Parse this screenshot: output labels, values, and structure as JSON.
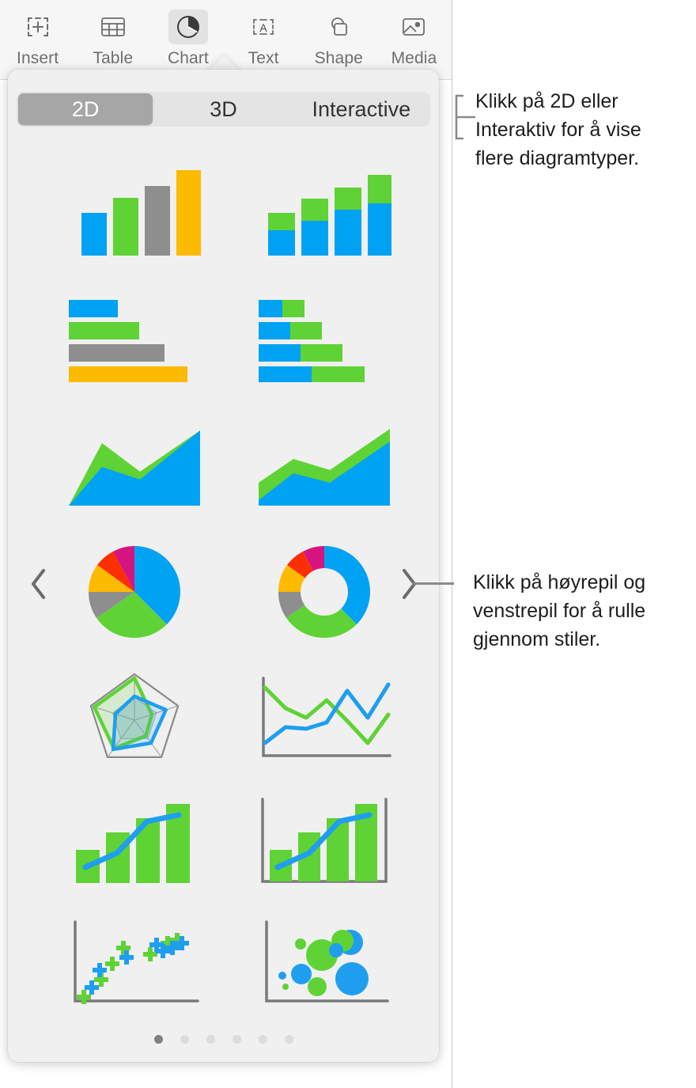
{
  "window": {
    "title": "Keynote chart picker"
  },
  "toolbar": {
    "items": [
      {
        "label": "Insert",
        "icon": "insert-icon",
        "active": false
      },
      {
        "label": "Table",
        "icon": "table-icon",
        "active": false
      },
      {
        "label": "Chart",
        "icon": "chart-icon",
        "active": true
      },
      {
        "label": "Text",
        "icon": "text-icon",
        "active": false
      },
      {
        "label": "Shape",
        "icon": "shape-icon",
        "active": false
      },
      {
        "label": "Media",
        "icon": "media-icon",
        "active": false
      }
    ]
  },
  "popover": {
    "segmented": {
      "options": [
        "2D",
        "3D",
        "Interactive"
      ],
      "selected": "2D"
    },
    "charts": [
      {
        "name": "column-chart",
        "type": "column",
        "colors": [
          "#00a2f3",
          "#5fd335",
          "#8e8e8e",
          "#fcba00"
        ],
        "values": [
          45,
          62,
          80,
          100
        ]
      },
      {
        "name": "stacked-column-chart",
        "type": "stacked-column",
        "colors": [
          "#00a2f3",
          "#5fd335"
        ],
        "series": [
          {
            "name": "blue",
            "values": [
              22,
              42,
              58,
              70
            ]
          },
          {
            "name": "green",
            "values": [
              28,
              30,
              35,
              40
            ]
          }
        ]
      },
      {
        "name": "bar-chart",
        "type": "bar",
        "colors": [
          "#00a2f3",
          "#5fd335",
          "#8e8e8e",
          "#fcba00"
        ],
        "values": [
          38,
          50,
          63,
          83
        ]
      },
      {
        "name": "stacked-bar-chart",
        "type": "stacked-bar",
        "colors": [
          "#00a2f3",
          "#5fd335"
        ],
        "series": [
          {
            "name": "blue",
            "values": [
              30,
              38,
              47,
              56
            ]
          },
          {
            "name": "green",
            "values": [
              20,
              28,
              36,
              44
            ]
          }
        ]
      },
      {
        "name": "area-chart",
        "type": "area",
        "colors": [
          "#5fd335",
          "#00a2f3"
        ],
        "series": [
          {
            "name": "green",
            "values": [
              0,
              72,
              40,
              44,
              96
            ]
          },
          {
            "name": "blue",
            "values": [
              0,
              46,
              32,
              60,
              100
            ]
          }
        ]
      },
      {
        "name": "stacked-area-chart",
        "type": "stacked-area",
        "colors": [
          "#5fd335",
          "#00a2f3"
        ],
        "series": [
          {
            "name": "green",
            "values": [
              22,
              62,
              44,
              62,
              100
            ]
          },
          {
            "name": "blue",
            "values": [
              8,
              36,
              30,
              50,
              88
            ]
          }
        ]
      },
      {
        "name": "pie-chart",
        "type": "pie",
        "colors": [
          "#00a2f3",
          "#5fd335",
          "#8e8e8e",
          "#fcba00",
          "#fc2f00",
          "#d6147f"
        ],
        "values": [
          33,
          28,
          10,
          11,
          10,
          8
        ]
      },
      {
        "name": "donut-chart",
        "type": "donut",
        "colors": [
          "#00a2f3",
          "#5fd335",
          "#8e8e8e",
          "#fcba00",
          "#fc2f00",
          "#d6147f"
        ],
        "values": [
          33,
          28,
          10,
          11,
          10,
          8
        ]
      },
      {
        "name": "radar-chart",
        "type": "radar",
        "colors": [
          "#5fd335",
          "#1f9ef0"
        ],
        "series": [
          {
            "name": "green",
            "values": [
              92,
              40,
              55,
              78,
              35
            ]
          },
          {
            "name": "blue",
            "values": [
              52,
              72,
              85,
              38,
              42
            ]
          }
        ]
      },
      {
        "name": "line-chart",
        "type": "line",
        "colors": [
          "#5fd335",
          "#1f9ef0"
        ],
        "series": [
          {
            "name": "green",
            "values": [
              88,
              58,
              62,
              36,
              84,
              28,
              60
            ]
          },
          {
            "name": "blue",
            "values": [
              18,
              44,
              40,
              76,
              92,
              50,
              92
            ]
          }
        ]
      },
      {
        "name": "combo-chart",
        "type": "combo",
        "colors": [
          "#5fd335",
          "#1f9ef0"
        ],
        "bars": [
          32,
          58,
          78,
          96
        ],
        "line": [
          10,
          30,
          72,
          80
        ]
      },
      {
        "name": "two-axis-chart",
        "type": "two-axis",
        "colors": [
          "#5fd335",
          "#1f9ef0"
        ],
        "bars": [
          32,
          58,
          78,
          96
        ],
        "line": [
          10,
          30,
          72,
          80
        ]
      },
      {
        "name": "scatter-chart",
        "type": "scatter",
        "colors": [
          "#5fd335",
          "#1f9ef0"
        ],
        "series": [
          {
            "name": "green",
            "points": [
              [
                4,
                4
              ],
              [
                13,
                22
              ],
              [
                27,
                42
              ],
              [
                38,
                56
              ],
              [
                62,
                50
              ],
              [
                72,
                58
              ],
              [
                80,
                62
              ]
            ]
          },
          {
            "name": "blue",
            "points": [
              [
                8,
                6
              ],
              [
                18,
                30
              ],
              [
                33,
                34
              ],
              [
                50,
                40
              ],
              [
                66,
                58
              ],
              [
                76,
                52
              ],
              [
                84,
                56
              ]
            ]
          }
        ]
      },
      {
        "name": "bubble-chart",
        "type": "bubble",
        "colors": [
          "#5fd335",
          "#1f9ef0"
        ],
        "series": [
          {
            "name": "green",
            "points": [
              [
                12,
                18,
                4
              ],
              [
                26,
                28,
                9
              ],
              [
                34,
                62,
                8
              ],
              [
                44,
                48,
                18
              ],
              [
                70,
                70,
                16
              ]
            ]
          },
          {
            "name": "blue",
            "points": [
              [
                8,
                30,
                4
              ],
              [
                26,
                34,
                11
              ],
              [
                58,
                60,
                7
              ],
              [
                76,
                66,
                12
              ],
              [
                72,
                30,
                18
              ]
            ]
          }
        ]
      }
    ],
    "pagination": {
      "total": 6,
      "current": 1
    }
  },
  "callouts": [
    {
      "name": "callout-2d-interactive",
      "text": "Klikk på 2D eller\nInteraktiv for å vise\nflere diagramtyper."
    },
    {
      "name": "callout-arrows",
      "text": "Klikk på høyrepil og\nvenstrepil for å rulle\ngjennom stiler."
    }
  ],
  "colors": {
    "blue": "#00a2f3",
    "green": "#5fd335",
    "gray": "#8e8e8e",
    "yellow": "#fcba00",
    "red": "#fc2f00",
    "magenta": "#d6147f",
    "popover_bg": "#f0f0f0",
    "segment_selected": "#a6a6a6"
  }
}
